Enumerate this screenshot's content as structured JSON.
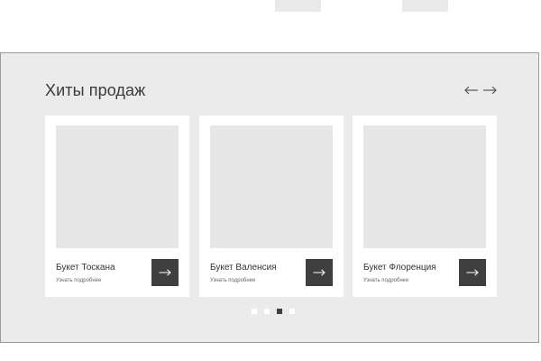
{
  "section": {
    "title": "Хиты продаж",
    "prev_icon": "arrow-left-icon",
    "next_icon": "arrow-right-icon"
  },
  "cards": [
    {
      "title": "Букет Тоскана",
      "link": "Узнать подробнее",
      "button_icon": "arrow-right-icon"
    },
    {
      "title": "Букет Валенсия",
      "link": "Узнать подробнее",
      "button_icon": "arrow-right-icon"
    },
    {
      "title": "Букет Флоренция",
      "link": "Узнать подробнее",
      "button_icon": "arrow-right-icon"
    }
  ],
  "pagination": {
    "count": 4,
    "active_index": 2
  },
  "colors": {
    "section_bg": "#ebebeb",
    "card_bg": "#ffffff",
    "button_bg": "#3f3f3f",
    "image_placeholder": "#e6e6e6"
  }
}
